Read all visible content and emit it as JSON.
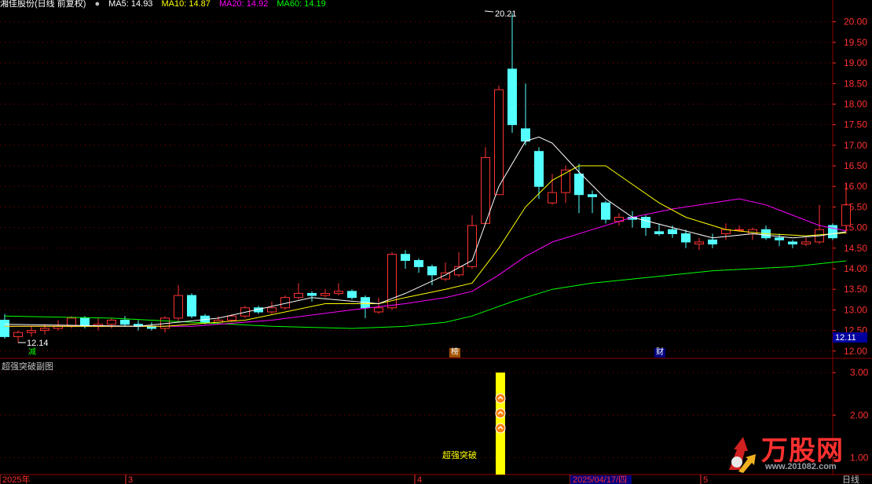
{
  "header": {
    "title": "湘佳股份(日线 前复权)",
    "ma5": "MA5: 14.93",
    "ma10": "MA10: 14.87",
    "ma20": "MA20: 14.92",
    "ma60": "MA60: 14.19"
  },
  "sub_panel": {
    "title": "超强突破副图",
    "signal_label": "超强突破",
    "y_ticks": [
      "3.00",
      "2.00",
      "1.00"
    ]
  },
  "annotations": {
    "high_label": "20.21",
    "low_label": "12.14",
    "current_price": "12.11",
    "marker_jian": "减",
    "marker_bang": "榜",
    "marker_cai": "财"
  },
  "x_axis": {
    "labels": [
      "2025年",
      "3",
      "4",
      "2025/04/17/四",
      "5"
    ],
    "period": "日线"
  },
  "watermark": {
    "brand": "万股网",
    "url": "www.201082.com"
  },
  "colors": {
    "up": "#ff3232",
    "down": "#54ffff",
    "ma5": "#ffffff",
    "ma10": "#ffff00",
    "ma20": "#ff00ff",
    "ma60": "#00ff00",
    "grid": "#8b0000",
    "signal": "#ffff00"
  },
  "chart_data": {
    "type": "candlestick",
    "y_ticks": [
      20.0,
      19.5,
      19.0,
      18.5,
      18.0,
      17.5,
      17.0,
      16.5,
      16.0,
      15.5,
      15.0,
      14.5,
      14.0,
      13.5,
      13.0,
      12.5,
      12.0
    ],
    "ylim": [
      11.9,
      20.3
    ],
    "candles": [
      [
        12.75,
        12.35,
        12.9,
        12.3
      ],
      [
        12.35,
        12.45,
        12.5,
        12.2
      ],
      [
        12.45,
        12.5,
        12.6,
        12.35
      ],
      [
        12.5,
        12.55,
        12.65,
        12.4
      ],
      [
        12.55,
        12.6,
        12.75,
        12.5
      ],
      [
        12.6,
        12.8,
        12.85,
        12.55
      ],
      [
        12.8,
        12.6,
        12.85,
        12.55
      ],
      [
        12.6,
        12.65,
        12.8,
        12.5
      ],
      [
        12.65,
        12.75,
        12.8,
        12.55
      ],
      [
        12.75,
        12.65,
        12.85,
        12.6
      ],
      [
        12.65,
        12.6,
        12.75,
        12.5
      ],
      [
        12.6,
        12.55,
        12.7,
        12.5
      ],
      [
        12.55,
        12.8,
        12.85,
        12.45
      ],
      [
        12.8,
        13.35,
        13.6,
        12.7
      ],
      [
        13.35,
        12.85,
        13.4,
        12.8
      ],
      [
        12.85,
        12.7,
        12.9,
        12.65
      ],
      [
        12.7,
        12.75,
        12.85,
        12.65
      ],
      [
        12.75,
        12.85,
        12.9,
        12.7
      ],
      [
        12.85,
        13.05,
        13.1,
        12.8
      ],
      [
        13.05,
        12.95,
        13.1,
        12.9
      ],
      [
        12.95,
        13.05,
        13.2,
        12.9
      ],
      [
        13.05,
        13.3,
        13.35,
        13.0
      ],
      [
        13.3,
        13.4,
        13.65,
        13.25
      ],
      [
        13.4,
        13.35,
        13.45,
        13.2
      ],
      [
        13.35,
        13.4,
        13.5,
        13.3
      ],
      [
        13.4,
        13.45,
        13.65,
        13.35
      ],
      [
        13.45,
        13.3,
        13.5,
        13.25
      ],
      [
        13.3,
        13.05,
        13.35,
        12.8
      ],
      [
        12.95,
        13.05,
        13.3,
        12.9
      ],
      [
        13.05,
        14.35,
        14.4,
        13.0
      ],
      [
        14.35,
        14.2,
        14.45,
        14.0
      ],
      [
        14.2,
        14.05,
        14.25,
        13.9
      ],
      [
        14.05,
        13.85,
        14.1,
        13.6
      ],
      [
        13.75,
        13.9,
        14.15,
        13.7
      ],
      [
        13.85,
        14.05,
        14.4,
        13.8
      ],
      [
        14.05,
        15.05,
        15.3,
        14.0
      ],
      [
        15.1,
        16.7,
        16.95,
        15.1
      ],
      [
        15.8,
        18.35,
        18.45,
        15.8
      ],
      [
        18.85,
        17.5,
        20.21,
        17.3
      ],
      [
        17.4,
        17.1,
        18.5,
        17.0
      ],
      [
        16.85,
        16.0,
        16.95,
        15.7
      ],
      [
        15.6,
        15.85,
        16.3,
        15.55
      ],
      [
        15.85,
        16.4,
        16.5,
        15.6
      ],
      [
        16.3,
        15.8,
        16.55,
        15.35
      ],
      [
        15.8,
        15.75,
        15.9,
        15.35
      ],
      [
        15.6,
        15.2,
        15.65,
        15.1
      ],
      [
        15.15,
        15.25,
        15.35,
        15.05
      ],
      [
        15.25,
        15.2,
        15.4,
        15.0
      ],
      [
        15.25,
        15.0,
        15.3,
        14.8
      ],
      [
        14.9,
        14.85,
        15.1,
        14.8
      ],
      [
        14.95,
        14.85,
        15.05,
        14.75
      ],
      [
        14.85,
        14.65,
        14.95,
        14.5
      ],
      [
        14.6,
        14.65,
        14.75,
        14.45
      ],
      [
        14.7,
        14.6,
        14.85,
        14.5
      ],
      [
        14.85,
        14.95,
        15.1,
        14.7
      ],
      [
        14.95,
        14.95,
        15.05,
        14.9
      ],
      [
        14.85,
        14.95,
        15.0,
        14.7
      ],
      [
        14.95,
        14.75,
        15.05,
        14.7
      ],
      [
        14.75,
        14.7,
        14.85,
        14.55
      ],
      [
        14.65,
        14.6,
        14.7,
        14.5
      ],
      [
        14.6,
        14.65,
        14.75,
        14.55
      ],
      [
        14.65,
        14.95,
        15.55,
        14.6
      ],
      [
        15.05,
        14.75,
        15.1,
        14.7
      ],
      [
        15.05,
        15.55,
        16.05,
        14.85
      ]
    ],
    "ma5": [
      [
        0,
        12.65
      ],
      [
        10,
        12.6
      ],
      [
        16,
        12.8
      ],
      [
        23,
        13.3
      ],
      [
        28,
        13.15
      ],
      [
        30,
        13.4
      ],
      [
        33,
        13.85
      ],
      [
        35,
        14.2
      ],
      [
        37,
        16.0
      ],
      [
        39,
        17.1
      ],
      [
        40,
        17.2
      ],
      [
        41,
        17.05
      ],
      [
        43,
        16.35
      ],
      [
        45,
        15.7
      ],
      [
        47,
        15.25
      ],
      [
        50,
        15.0
      ],
      [
        53,
        14.75
      ],
      [
        56,
        14.85
      ],
      [
        59,
        14.75
      ],
      [
        61,
        14.8
      ],
      [
        63,
        14.9
      ]
    ],
    "ma10": [
      [
        0,
        12.6
      ],
      [
        12,
        12.6
      ],
      [
        18,
        12.75
      ],
      [
        24,
        13.15
      ],
      [
        28,
        13.15
      ],
      [
        30,
        13.3
      ],
      [
        33,
        13.5
      ],
      [
        35,
        13.65
      ],
      [
        37,
        14.5
      ],
      [
        39,
        15.5
      ],
      [
        41,
        16.15
      ],
      [
        43,
        16.5
      ],
      [
        45,
        16.5
      ],
      [
        47,
        16.05
      ],
      [
        49,
        15.6
      ],
      [
        51,
        15.25
      ],
      [
        54,
        14.95
      ],
      [
        57,
        14.85
      ],
      [
        60,
        14.8
      ],
      [
        63,
        14.87
      ]
    ],
    "ma20": [
      [
        0,
        12.6
      ],
      [
        14,
        12.6
      ],
      [
        20,
        12.75
      ],
      [
        26,
        13.0
      ],
      [
        30,
        13.15
      ],
      [
        33,
        13.3
      ],
      [
        35,
        13.45
      ],
      [
        37,
        13.85
      ],
      [
        39,
        14.3
      ],
      [
        41,
        14.65
      ],
      [
        44,
        14.95
      ],
      [
        47,
        15.25
      ],
      [
        50,
        15.45
      ],
      [
        53,
        15.6
      ],
      [
        55,
        15.7
      ],
      [
        57,
        15.55
      ],
      [
        59,
        15.3
      ],
      [
        61,
        15.05
      ],
      [
        63,
        14.92
      ]
    ],
    "ma60": [
      [
        0,
        12.85
      ],
      [
        8,
        12.8
      ],
      [
        14,
        12.7
      ],
      [
        20,
        12.6
      ],
      [
        26,
        12.55
      ],
      [
        30,
        12.6
      ],
      [
        33,
        12.7
      ],
      [
        35,
        12.85
      ],
      [
        38,
        13.2
      ],
      [
        41,
        13.5
      ],
      [
        44,
        13.65
      ],
      [
        47,
        13.75
      ],
      [
        50,
        13.85
      ],
      [
        53,
        13.95
      ],
      [
        56,
        14.0
      ],
      [
        59,
        14.05
      ],
      [
        63,
        14.19
      ]
    ],
    "signal_bars": [
      {
        "index": 37,
        "value": 3.0
      }
    ],
    "signal_icons_count": 3,
    "sub_ylim": [
      0.6,
      3.3
    ]
  }
}
